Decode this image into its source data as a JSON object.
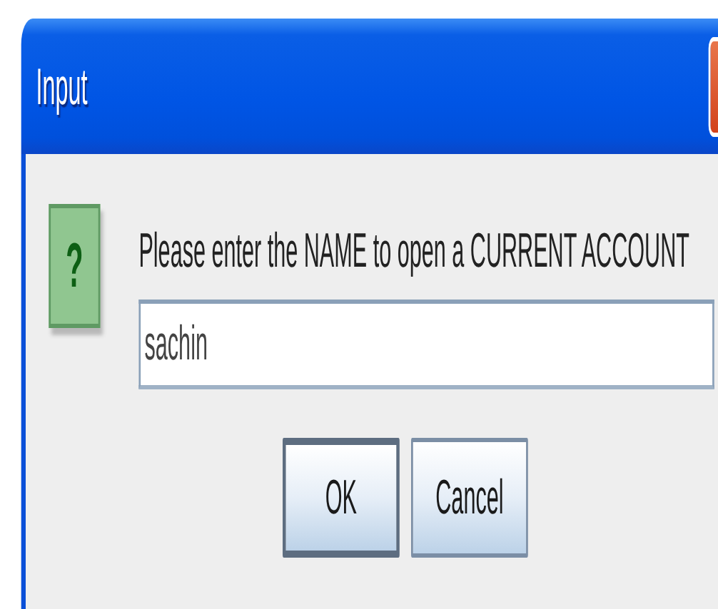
{
  "window": {
    "title": "Input"
  },
  "dialog": {
    "icon_glyph": "?",
    "message": "Please enter the NAME to open a CURRENT ACCOUNT",
    "field": {
      "value": "sachin"
    }
  },
  "buttons": [
    {
      "label": "OK",
      "default": true
    },
    {
      "label": "Cancel",
      "default": false
    }
  ]
}
